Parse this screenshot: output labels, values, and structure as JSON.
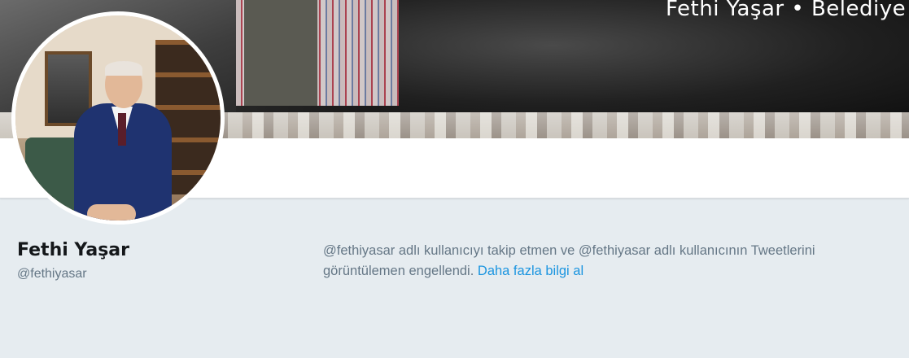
{
  "banner": {
    "text": "Fethi Yaşar • Belediye B"
  },
  "profile": {
    "name": "Fethi Yaşar",
    "handle": "@fethiyasar"
  },
  "blocked_notice": {
    "message": "@fethiyasar adlı kullanıcıyı takip etmen ve @fethiyasar adlı kullanıcının Tweetlerini görüntülemen engellendi.",
    "link_label": "Daha fazla bilgi al"
  },
  "colors": {
    "link": "#1b95e0",
    "background": "#e6ecf0",
    "text_secondary": "#657786",
    "text_primary": "#14171a"
  }
}
